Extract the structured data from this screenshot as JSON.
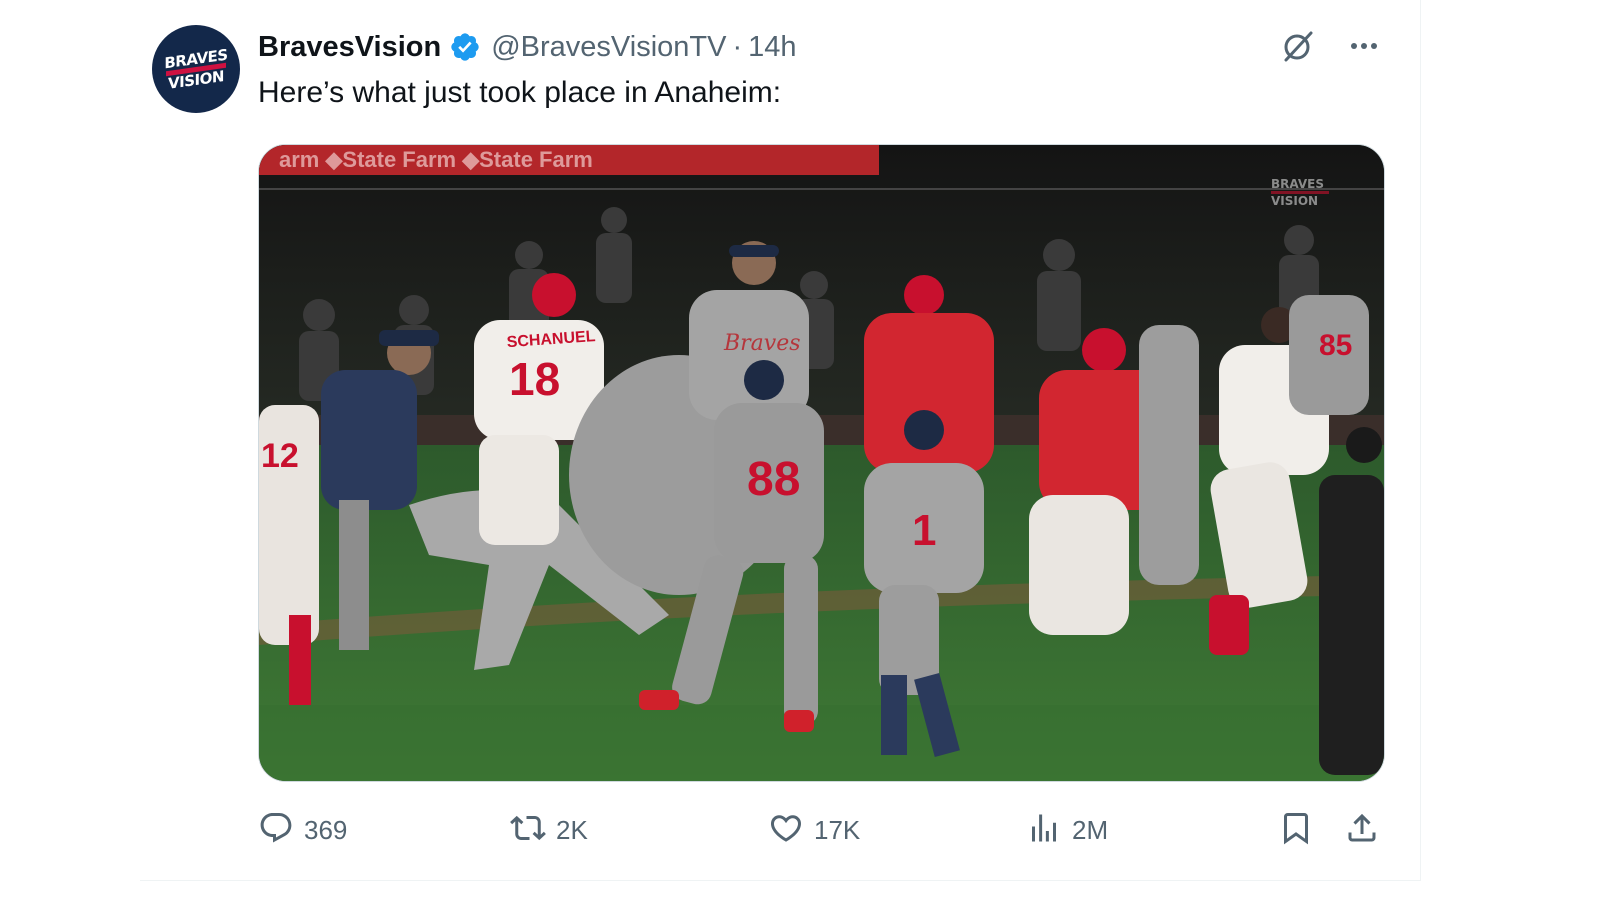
{
  "author": {
    "display_name": "BravesVision",
    "handle": "@BravesVisionTV",
    "separator": "·",
    "time": "14h",
    "avatar_text": [
      "BRAVES",
      "VISION"
    ],
    "verified": true
  },
  "tweet": {
    "text": "Here’s what just took place in Anaheim:"
  },
  "media": {
    "type": "video-still",
    "watermark": "BRAVES VISION",
    "jersey_numbers": [
      "18",
      "88",
      "1",
      "12",
      "85"
    ],
    "jersey_names": [
      "SCHANUEL"
    ]
  },
  "actions": {
    "replies": "369",
    "reposts": "2K",
    "likes": "17K",
    "views": "2M"
  },
  "icons": [
    "grok-icon",
    "more-icon",
    "reply-icon",
    "repost-icon",
    "like-icon",
    "views-icon",
    "bookmark-icon",
    "share-icon",
    "verified-badge-icon"
  ],
  "colors": {
    "text_primary": "#0f1419",
    "text_secondary": "#536471",
    "verified_blue": "#1d9bf0",
    "border": "#cfd9de"
  }
}
